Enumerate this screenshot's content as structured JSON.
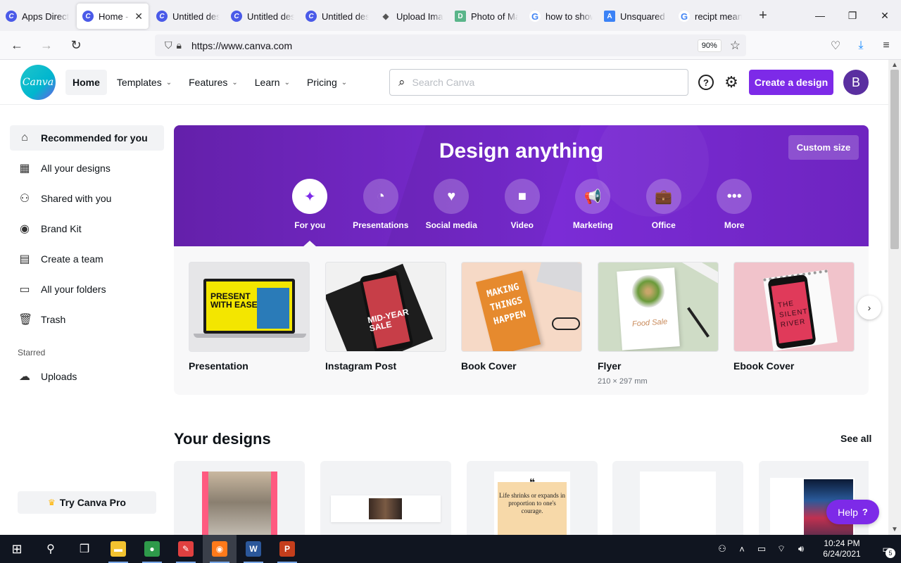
{
  "browser": {
    "tabs": [
      {
        "title": "Apps Directory",
        "favicon": "C",
        "kind": "canva",
        "active": false
      },
      {
        "title": "Home - Canva",
        "favicon": "C",
        "kind": "canva",
        "active": true
      },
      {
        "title": "Untitled design",
        "favicon": "C",
        "kind": "canva",
        "active": false
      },
      {
        "title": "Untitled design",
        "favicon": "C",
        "kind": "canva",
        "active": false
      },
      {
        "title": "Untitled design",
        "favicon": "C",
        "kind": "canva",
        "active": false
      },
      {
        "title": "Upload Image",
        "favicon": "◆",
        "kind": "upload",
        "active": false
      },
      {
        "title": "Photo of Man",
        "favicon": "D",
        "kind": "d",
        "active": false
      },
      {
        "title": "how to show",
        "favicon": "G",
        "kind": "g",
        "active": false
      },
      {
        "title": "Unsquared",
        "favicon": "A",
        "kind": "u",
        "active": false
      },
      {
        "title": "recipt meaning",
        "favicon": "G",
        "kind": "g",
        "active": false
      }
    ],
    "tab_close": "✕",
    "new_tab": "+",
    "window_controls": {
      "minimize": "—",
      "maximize": "❐",
      "close": "✕"
    },
    "url": "https://www.canva.com",
    "zoom": "90%"
  },
  "header": {
    "logo_text": "Canva",
    "nav": [
      {
        "label": "Home",
        "has_menu": false,
        "active": true
      },
      {
        "label": "Templates",
        "has_menu": true,
        "active": false
      },
      {
        "label": "Features",
        "has_menu": true,
        "active": false
      },
      {
        "label": "Learn",
        "has_menu": true,
        "active": false
      },
      {
        "label": "Pricing",
        "has_menu": true,
        "active": false
      }
    ],
    "search_placeholder": "Search Canva",
    "help_icon": "?",
    "create_label": "Create a design",
    "avatar_initial": "B"
  },
  "sidebar": {
    "items": [
      {
        "label": "Recommended for you",
        "icon": "home-icon",
        "glyph": "⌂",
        "active": true
      },
      {
        "label": "All your designs",
        "icon": "grid-icon",
        "glyph": "▦",
        "active": false
      },
      {
        "label": "Shared with you",
        "icon": "people-icon",
        "glyph": "⚇",
        "active": false
      },
      {
        "label": "Brand Kit",
        "icon": "brand-kit-icon",
        "glyph": "◉",
        "active": false
      },
      {
        "label": "Create a team",
        "icon": "team-icon",
        "glyph": "▤",
        "active": false
      },
      {
        "label": "All your folders",
        "icon": "folder-icon",
        "glyph": "▭",
        "active": false
      },
      {
        "label": "Trash",
        "icon": "trash-icon",
        "glyph": "🗑",
        "active": false
      }
    ],
    "starred_label": "Starred",
    "uploads": {
      "label": "Uploads",
      "icon": "upload-cloud-icon",
      "glyph": "☁"
    },
    "pro_label": "Try Canva Pro"
  },
  "hero": {
    "title": "Design anything",
    "custom_size": "Custom size",
    "categories": [
      {
        "label": "For you",
        "icon": "sparkle-icon",
        "glyph": "✦",
        "active": true
      },
      {
        "label": "Presentations",
        "icon": "presentation-icon",
        "glyph": "◔",
        "active": false
      },
      {
        "label": "Social media",
        "icon": "heart-chat-icon",
        "glyph": "♥",
        "active": false
      },
      {
        "label": "Video",
        "icon": "video-camera-icon",
        "glyph": "■",
        "active": false
      },
      {
        "label": "Marketing",
        "icon": "megaphone-icon",
        "glyph": "📢",
        "active": false
      },
      {
        "label": "Office",
        "icon": "briefcase-icon",
        "glyph": "💼",
        "active": false
      },
      {
        "label": "More",
        "icon": "more-icon",
        "glyph": "•••",
        "active": false
      }
    ]
  },
  "templates": [
    {
      "name": "Presentation",
      "sub": "",
      "art": "pres",
      "art_text": "PRESENT\nWITH EASE"
    },
    {
      "name": "Instagram Post",
      "sub": "",
      "art": "insta",
      "art_text": "MID-YEAR\nSALE"
    },
    {
      "name": "Book Cover",
      "sub": "",
      "art": "book",
      "art_text": "MAKING\nTHINGS\nHAPPEN"
    },
    {
      "name": "Flyer",
      "sub": "210 × 297 mm",
      "art": "flyer",
      "art_text": "Food Sale"
    },
    {
      "name": "Ebook Cover",
      "sub": "",
      "art": "ebook",
      "art_text": "THE\nSILENT\nRIVER"
    }
  ],
  "your_designs": {
    "title": "Your designs",
    "see_all": "See all",
    "quote_text": "Life shrinks or expands in proportion to one's courage.",
    "quote_mark": "❝"
  },
  "help_label": "Help",
  "help_q": "?",
  "taskbar": {
    "time": "10:24 PM",
    "date": "6/24/2021",
    "notification_count": "5",
    "apps": [
      {
        "name": "file-explorer-icon",
        "glyph": "▬",
        "color": "#f2c230",
        "run": true,
        "active": false
      },
      {
        "name": "chrome-icon",
        "glyph": "●",
        "color": "#2e9a4a",
        "run": true,
        "active": false
      },
      {
        "name": "paint-icon",
        "glyph": "✎",
        "color": "#e04040",
        "run": true,
        "active": false
      },
      {
        "name": "firefox-icon",
        "glyph": "◉",
        "color": "#ff7a1a",
        "run": true,
        "active": true
      },
      {
        "name": "word-icon",
        "glyph": "W",
        "color": "#2b579a",
        "run": true,
        "active": false
      },
      {
        "name": "powerpoint-icon",
        "glyph": "P",
        "color": "#c43e1c",
        "run": true,
        "active": false
      }
    ]
  }
}
